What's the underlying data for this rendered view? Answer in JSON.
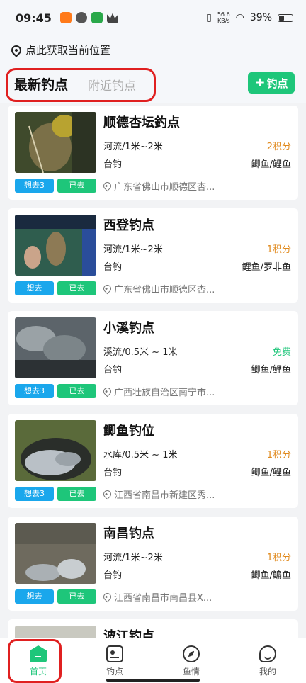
{
  "status_bar": {
    "time": "09:45",
    "net_speed_value": "56.6",
    "net_speed_unit": "KB/s",
    "battery": "39%"
  },
  "header": {
    "location_text": "点此获取当前位置",
    "tabs": [
      {
        "label": "最新钓点",
        "active": true
      },
      {
        "label": "附近钓点",
        "active": false
      }
    ],
    "add_button_plus": "+",
    "add_button_label": "钓点",
    "accent_color": "#1ec67a",
    "highlight_color": "#e02020"
  },
  "spots": [
    {
      "title": "顺德杏坛釣点",
      "water": "河流/1米~2米",
      "points": "2积分",
      "points_type": "paid",
      "method": "台钓",
      "fish": "鲫鱼/鲤鱼",
      "address": "广东省佛山市顺德区杏...",
      "want": "想去3",
      "been": "已去"
    },
    {
      "title": "西登钓点",
      "water": "河流/1米~2米",
      "points": "1积分",
      "points_type": "paid",
      "method": "台钓",
      "fish": "鲤鱼/罗非鱼",
      "address": "广东省佛山市顺德区杏...",
      "want": "想去",
      "been": "已去"
    },
    {
      "title": "小溪钓点",
      "water": "溪流/0.5米 ~ 1米",
      "points": "免费",
      "points_type": "free",
      "method": "台钓",
      "fish": "鲫鱼/鲤鱼",
      "address": "广西壮族自治区南宁市...",
      "want": "想去3",
      "been": "已去"
    },
    {
      "title": "鲫鱼钓位",
      "water": "水库/0.5米 ~ 1米",
      "points": "1积分",
      "points_type": "paid",
      "method": "台钓",
      "fish": "鲫鱼/鲤鱼",
      "address": "江西省南昌市新建区秀...",
      "want": "想去3",
      "been": "已去"
    },
    {
      "title": "南昌钓点",
      "water": "河流/1米~2米",
      "points": "1积分",
      "points_type": "paid",
      "method": "台钓",
      "fish": "鲫鱼/鳊鱼",
      "address": "江西省南昌市南昌县X...",
      "want": "想去",
      "been": "已去"
    },
    {
      "title": "波江钓点",
      "water": "",
      "points": "",
      "points_type": "paid",
      "method": "",
      "fish": "",
      "address": "",
      "want": "",
      "been": ""
    }
  ],
  "bottom_nav": [
    {
      "label": "首页",
      "icon": "home-icon",
      "active": true
    },
    {
      "label": "钓点",
      "icon": "spot-icon",
      "active": false
    },
    {
      "label": "鱼情",
      "icon": "compass-icon",
      "active": false
    },
    {
      "label": "我的",
      "icon": "face-icon",
      "active": false
    }
  ]
}
